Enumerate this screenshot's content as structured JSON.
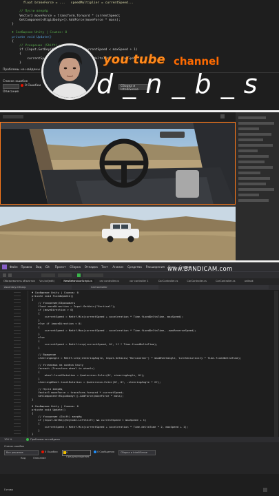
{
  "top_code": {
    "lines": [
      {
        "cls": "c-meth",
        "text": "          float brakeForce = ...   speedMultiplier = currentSpeed..."
      },
      {
        "cls": "",
        "text": ""
      },
      {
        "cls": "c-comment",
        "text": "        // Пусти вперёд"
      },
      {
        "cls": "",
        "text": "        Vector3 moveForce = transform.forward * currentSpeed;"
      },
      {
        "cls": "",
        "text": "        GetComponent<Rigidbody>().AddForce(moveForce * mass);"
      },
      {
        "cls": "",
        "text": "    }"
      },
      {
        "cls": "",
        "text": ""
      },
      {
        "cls": "c-comment",
        "text": "    ♦ Сообщение Unity | Ссылок: 0"
      },
      {
        "cls": "c-kw",
        "text": "    private void Update()"
      },
      {
        "cls": "",
        "text": "    {"
      },
      {
        "cls": "c-comment",
        "text": "        // Ускорение (Shift) на кнопке"
      },
      {
        "cls": "",
        "text": "        if (Input.GetKey(Ke               currentSpeed < maxSpeed + 1)"
      },
      {
        "cls": "",
        "text": "        {"
      },
      {
        "cls": "",
        "text": "            currentSpeed = M              Time.deltaTime * 2, maxSpeed);"
      },
      {
        "cls": "",
        "text": "        }"
      }
    ],
    "problems_label": "Проблемы не найдены",
    "error_list_label": "Список ошибок",
    "errors_count": "0 Ошибки",
    "build_label": "Сборка и IntelliSense",
    "description_label": "Описание"
  },
  "logo": {
    "you_tube": "you tube",
    "channel": "channel",
    "name": "d _ n _ b _ s"
  },
  "vs": {
    "menu": [
      "Файл",
      "Правка",
      "Вид",
      "Git",
      "Проект",
      "Сборка",
      "Отладка",
      "Тест",
      "Анализ",
      "Средства",
      "Расширения",
      "Окно",
      "Справка"
    ],
    "bandicam": "www.BANDICAM.com",
    "tabs": [
      "Обозреватель объектов",
      "Vcs.txt(edit)",
      "NewBehaviourScript.cs",
      "car controller.cs",
      "car controller 1",
      "CarController.cs",
      "CarController.cs",
      "CarController.cs",
      "unitask"
    ],
    "nav_left": "Assembly-CSharp",
    "nav_mid": "CarController",
    "code": [
      {
        "cls": "c-comment",
        "text": "♦ Сообщение Unity | Ссылок: 0"
      },
      {
        "cls": "c-kw",
        "text": "private void FixedUpdate()"
      },
      {
        "cls": "",
        "text": "{"
      },
      {
        "cls": "c-comment",
        "text": "    // Ускорение/Сбрасывать"
      },
      {
        "cls": "",
        "text": "    float moveDirection = Input.GetAxis(\"Vertical\");"
      },
      {
        "cls": "",
        "text": "    if (moveDirection > 0)"
      },
      {
        "cls": "",
        "text": "    {"
      },
      {
        "cls": "",
        "text": "        currentSpeed = Mathf.Min(currentSpeed + acceleration * Time.fixedDeltaTime, maxSpeed);"
      },
      {
        "cls": "",
        "text": "    }"
      },
      {
        "cls": "",
        "text": "    else if (moveDirection < 0)"
      },
      {
        "cls": "",
        "text": "    {"
      },
      {
        "cls": "",
        "text": "        currentSpeed = Mathf.Max(currentSpeed - acceleration * Time.fixedDeltaTime, -maxReverseSpeed);"
      },
      {
        "cls": "",
        "text": "    }"
      },
      {
        "cls": "",
        "text": "    else"
      },
      {
        "cls": "",
        "text": "    {"
      },
      {
        "cls": "",
        "text": "        currentSpeed = Mathf.Lerp(currentSpeed, 0f, 1f * Time.fixedDeltaTime);"
      },
      {
        "cls": "",
        "text": "    }"
      },
      {
        "cls": "",
        "text": ""
      },
      {
        "cls": "c-comment",
        "text": "    // Вращение"
      },
      {
        "cls": "",
        "text": "    steeringAngle = Mathf.Lerp(steeringAngle, Input.GetAxis(\"Horizontal\") * maxWheelAngle, turnSensitivity * Time.fixedDeltaTime);"
      },
      {
        "cls": "",
        "text": ""
      },
      {
        "cls": "c-comment",
        "text": "    // Установка на колёса Unity"
      },
      {
        "cls": "",
        "text": "    foreach (Transform wheel in wheels)"
      },
      {
        "cls": "",
        "text": "    {"
      },
      {
        "cls": "",
        "text": "        wheel.localRotation = Quaternion.Euler(0f, steeringAngle, 0f);"
      },
      {
        "cls": "",
        "text": "    }"
      },
      {
        "cls": "",
        "text": "    steeringWheel.localRotation = Quaternion.Euler(0f, 0f, -steeringAngle * 2f);"
      },
      {
        "cls": "",
        "text": ""
      },
      {
        "cls": "c-comment",
        "text": "    // Пусти вперёд"
      },
      {
        "cls": "",
        "text": "    Vector3 moveForce = transform.forward * currentSpeed;"
      },
      {
        "cls": "",
        "text": "    GetComponent<Rigidbody>().AddForce(moveForce * mass);"
      },
      {
        "cls": "",
        "text": "}"
      },
      {
        "cls": "",
        "text": ""
      },
      {
        "cls": "c-comment",
        "text": "♦ Сообщение Unity | Ссылок: 0"
      },
      {
        "cls": "c-kw",
        "text": "private void Update()"
      },
      {
        "cls": "",
        "text": "{"
      },
      {
        "cls": "c-comment",
        "text": "    // Ускорение (Shift) вперёд"
      },
      {
        "cls": "",
        "text": "    if (Input.GetKey(KeyCode.LeftShift) && currentSpeed < maxSpeed + 1)"
      },
      {
        "cls": "",
        "text": "    {"
      },
      {
        "cls": "",
        "text": "        currentSpeed = Mathf.Min(currentSpeed + acceleration * Time.deltaTime * 2, maxSpeed + 1);"
      },
      {
        "cls": "",
        "text": "    }"
      },
      {
        "cls": "",
        "text": "}"
      }
    ],
    "zoom": "100 %",
    "problems": "Проблемы не найдены",
    "error_list": "Список ошибок",
    "scope": "Все решение",
    "errors": "0 Ошибки",
    "warnings": "0 Предупреждения",
    "messages": "0 Сообщения",
    "build": "Сборка и IntelliSense",
    "col_code": "Код",
    "col_desc": "Описание",
    "ready": "Готово"
  }
}
